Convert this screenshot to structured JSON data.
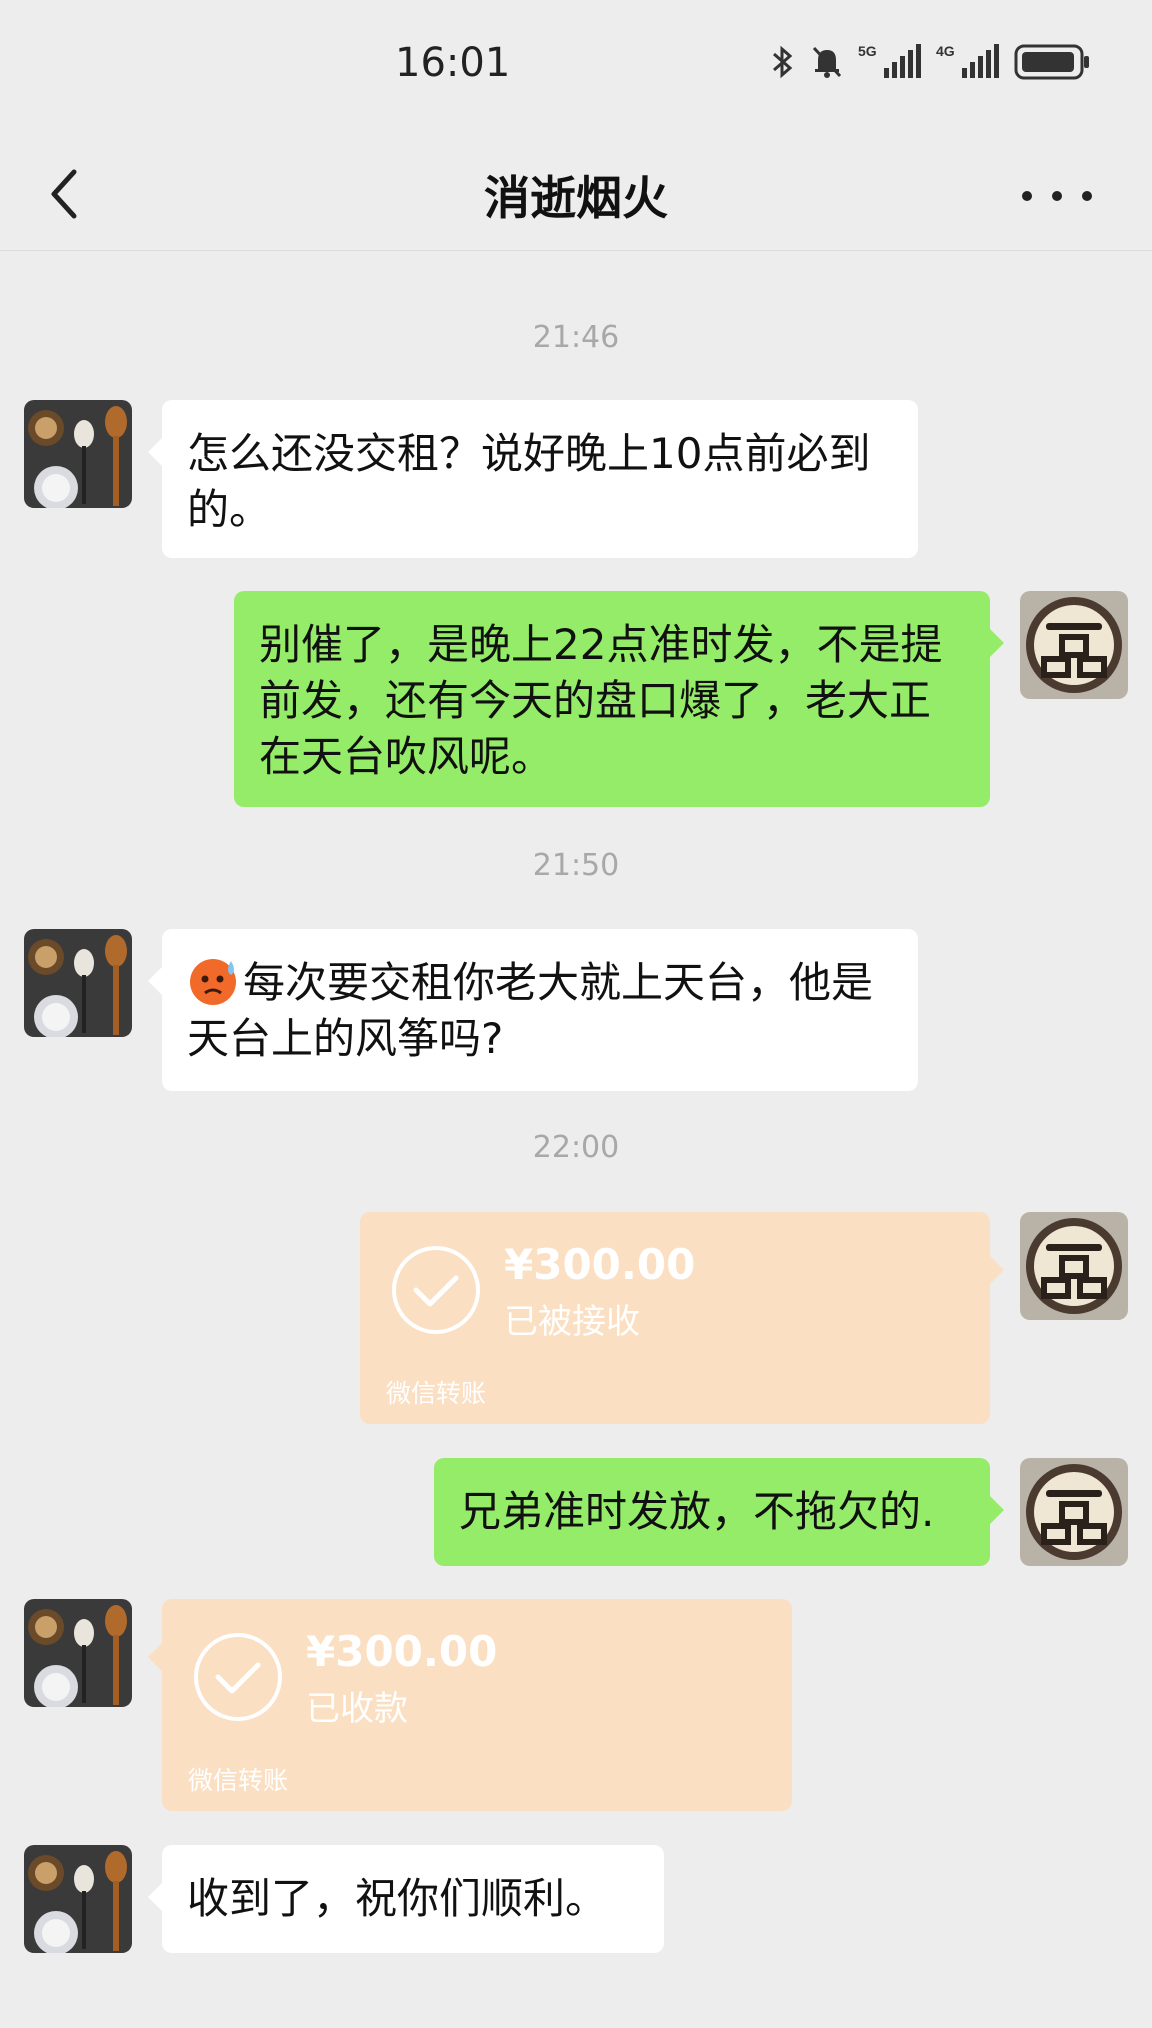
{
  "status_bar": {
    "time": "16:01",
    "network_1": "5G",
    "network_2": "4G",
    "icons": [
      "bluetooth-icon",
      "mute-bell-icon",
      "signal-5g-icon",
      "signal-4g-icon",
      "battery-icon"
    ]
  },
  "header": {
    "title": "消逝烟火",
    "back_icon": "chevron-left-icon",
    "more_icon": "more-dots-icon"
  },
  "timestamps": [
    "21:46",
    "21:50",
    "22:00"
  ],
  "messages": [
    {
      "side": "in",
      "text": "怎么还没交租？说好晚上10点前必到的。"
    },
    {
      "side": "out",
      "text": "别催了，是晚上22点准时发，不是提前发，还有今天的盘口爆了，老大正在天台吹风呢。"
    },
    {
      "side": "in",
      "emoji": "anxious-sweat-face-emoji",
      "text": "每次要交租你老大就上天台，他是天台上的风筝吗?"
    },
    {
      "side": "out",
      "type": "transfer",
      "amount": "¥300.00",
      "status": "已被接收",
      "footer": "微信转账"
    },
    {
      "side": "out",
      "text": "兄弟准时发放，不拖欠的."
    },
    {
      "side": "in",
      "type": "transfer",
      "amount": "¥300.00",
      "status": "已收款",
      "footer": "微信转账"
    },
    {
      "side": "in",
      "text": "收到了，祝你们顺利。"
    }
  ],
  "colors": {
    "background": "#ededed",
    "outgoing_bubble": "#95ec69",
    "incoming_bubble": "#ffffff",
    "transfer_bubble": "#fbdfc2",
    "timestamp": "#a8a8a8"
  }
}
